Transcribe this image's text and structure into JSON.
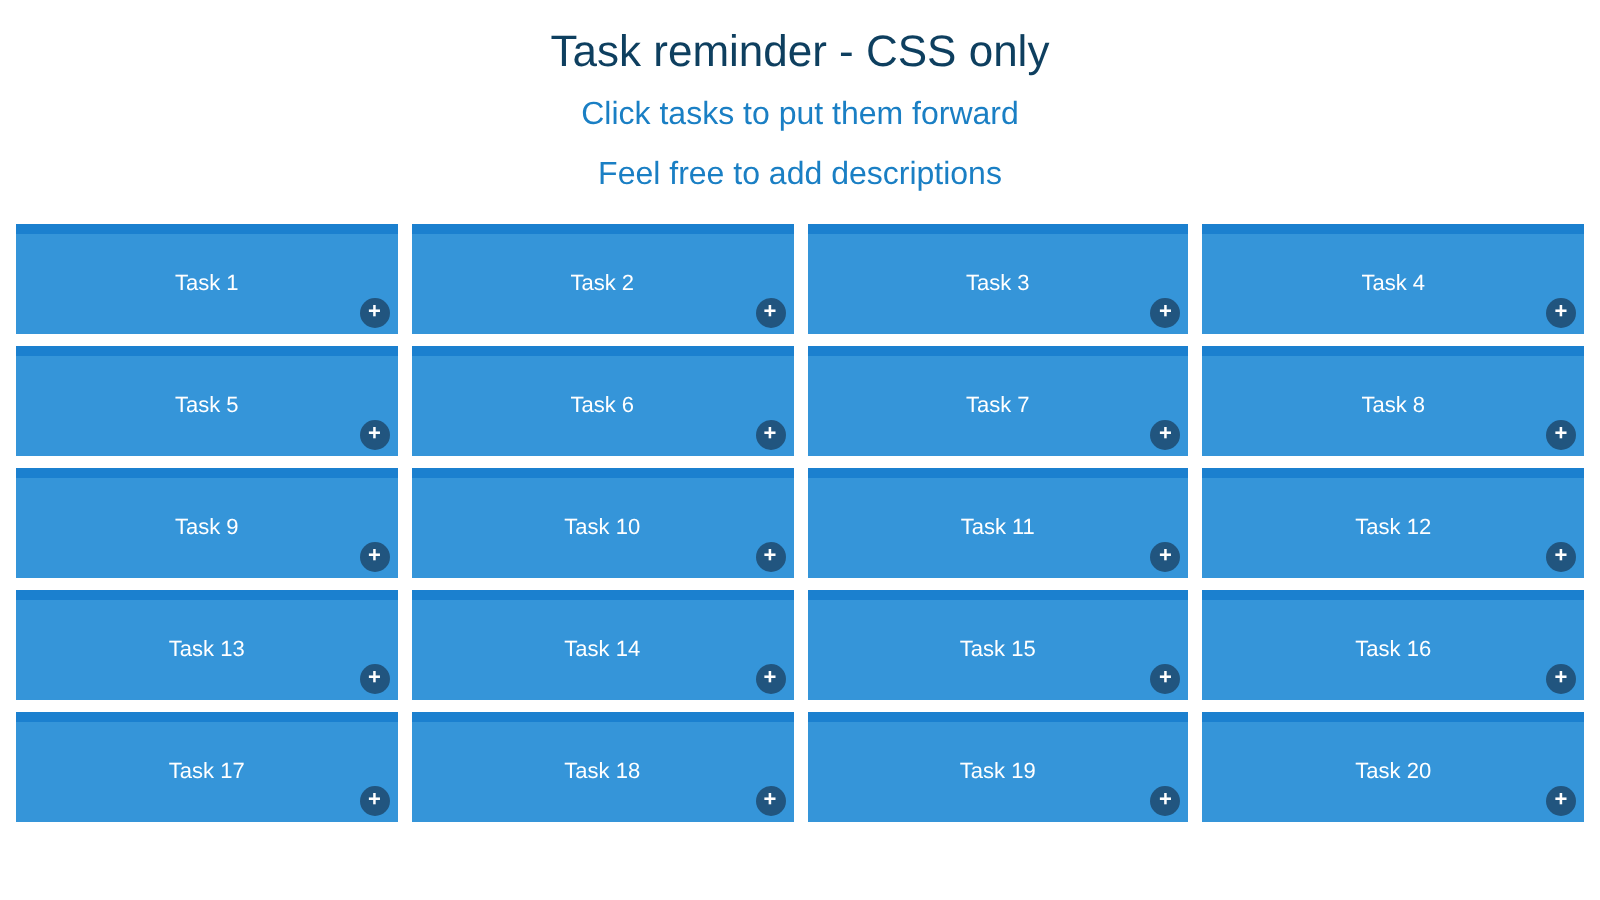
{
  "title": "Task reminder - CSS only",
  "subtitles": [
    "Click tasks to put them forward",
    "Feel free to add descriptions"
  ],
  "tasks": [
    {
      "label": "Task 1",
      "button": "+"
    },
    {
      "label": "Task 2",
      "button": "+"
    },
    {
      "label": "Task 3",
      "button": "+"
    },
    {
      "label": "Task 4",
      "button": "+"
    },
    {
      "label": "Task 5",
      "button": "+"
    },
    {
      "label": "Task 6",
      "button": "+"
    },
    {
      "label": "Task 7",
      "button": "+"
    },
    {
      "label": "Task 8",
      "button": "+"
    },
    {
      "label": "Task 9",
      "button": "+"
    },
    {
      "label": "Task 10",
      "button": "+"
    },
    {
      "label": "Task 11",
      "button": "+"
    },
    {
      "label": "Task 12",
      "button": "+"
    },
    {
      "label": "Task 13",
      "button": "+"
    },
    {
      "label": "Task 14",
      "button": "+"
    },
    {
      "label": "Task 15",
      "button": "+"
    },
    {
      "label": "Task 16",
      "button": "+"
    },
    {
      "label": "Task 17",
      "button": "+"
    },
    {
      "label": "Task 18",
      "button": "+"
    },
    {
      "label": "Task 19",
      "button": "+"
    },
    {
      "label": "Task 20",
      "button": "+"
    }
  ]
}
